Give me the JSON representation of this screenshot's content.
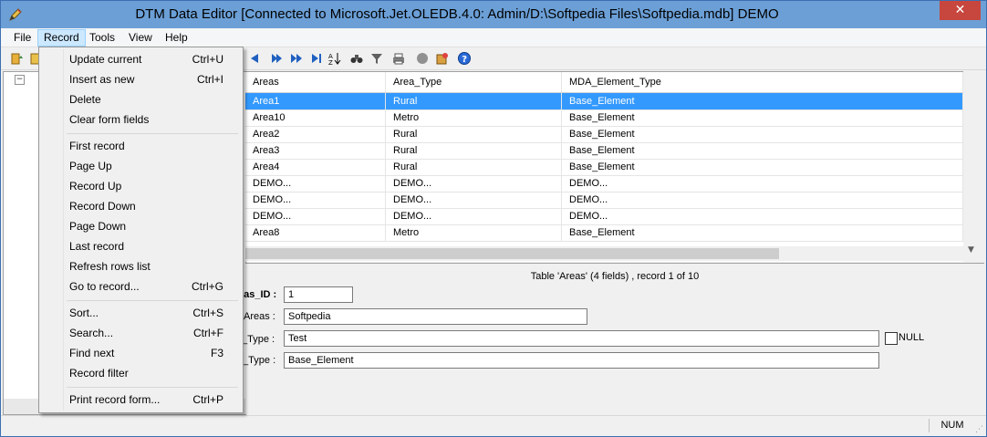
{
  "window": {
    "title": "DTM Data Editor [Connected to Microsoft.Jet.OLEDB.4.0: Admin/D:\\Softpedia Files\\Softpedia.mdb] DEMO",
    "close": "✕"
  },
  "menubar": {
    "items": [
      "File",
      "Record",
      "Tools",
      "View",
      "Help"
    ]
  },
  "toolbar": {
    "icons": [
      "open-db-icon",
      "connect-icon",
      "first-icon",
      "prev-icon",
      "next-icon",
      "last-icon",
      "sort-icon",
      "search-icon",
      "filter-icon",
      "print-icon",
      "stop-icon",
      "settings-icon",
      "help-icon"
    ]
  },
  "grid": {
    "columns": [
      "Areas",
      "Area_Type",
      "MDA_Element_Type"
    ],
    "rows": [
      [
        "Area1",
        "Rural",
        "Base_Element"
      ],
      [
        "Area10",
        "Metro",
        "Base_Element"
      ],
      [
        "Area2",
        "Rural",
        "Base_Element"
      ],
      [
        "Area3",
        "Rural",
        "Base_Element"
      ],
      [
        "Area4",
        "Rural",
        "Base_Element"
      ],
      [
        "DEMO...",
        "DEMO...",
        "DEMO..."
      ],
      [
        "DEMO...",
        "DEMO...",
        "DEMO..."
      ],
      [
        "DEMO...",
        "DEMO...",
        "DEMO..."
      ],
      [
        "Area8",
        "Metro",
        "Base_Element"
      ]
    ]
  },
  "form": {
    "status": "Table 'Areas' (4 fields) , record 1 of 10",
    "fields": [
      {
        "label": "eas_ID :",
        "value": "1"
      },
      {
        "label": "Areas :",
        "value": "Softpedia"
      },
      {
        "label": "_Type :",
        "value": "Test"
      },
      {
        "label": "t_Type :",
        "value": "Base_Element"
      }
    ],
    "null_label": "NULL"
  },
  "statusbar": {
    "num": "NUM"
  },
  "record_menu": {
    "groups": [
      [
        {
          "label": "Update current",
          "shortcut": "Ctrl+U"
        },
        {
          "label": "Insert as new",
          "shortcut": "Ctrl+I"
        },
        {
          "label": "Delete",
          "shortcut": ""
        },
        {
          "label": "Clear form fields",
          "shortcut": ""
        }
      ],
      [
        {
          "label": "First record",
          "shortcut": ""
        },
        {
          "label": "Page Up",
          "shortcut": ""
        },
        {
          "label": "Record Up",
          "shortcut": ""
        },
        {
          "label": "Record Down",
          "shortcut": ""
        },
        {
          "label": "Page Down",
          "shortcut": ""
        },
        {
          "label": "Last record",
          "shortcut": ""
        },
        {
          "label": "Refresh rows list",
          "shortcut": ""
        },
        {
          "label": "Go to record...",
          "shortcut": "Ctrl+G"
        }
      ],
      [
        {
          "label": "Sort...",
          "shortcut": "Ctrl+S"
        },
        {
          "label": "Search...",
          "shortcut": "Ctrl+F"
        },
        {
          "label": "Find next",
          "shortcut": "F3"
        },
        {
          "label": "Record filter",
          "shortcut": ""
        }
      ],
      [
        {
          "label": "Print record form...",
          "shortcut": "Ctrl+P"
        }
      ]
    ]
  }
}
